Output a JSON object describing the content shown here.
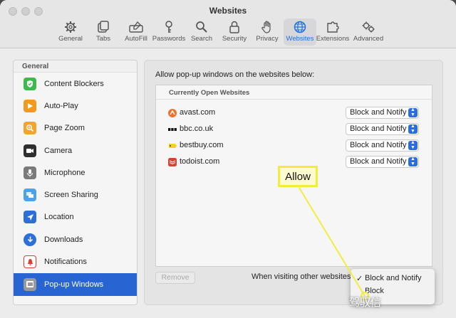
{
  "window": {
    "title": "Websites"
  },
  "toolbar": {
    "items": [
      {
        "label": "General",
        "icon": "gear-icon"
      },
      {
        "label": "Tabs",
        "icon": "tabs-icon"
      },
      {
        "label": "AutoFill",
        "icon": "autofill-icon"
      },
      {
        "label": "Passwords",
        "icon": "key-icon"
      },
      {
        "label": "Search",
        "icon": "search-icon"
      },
      {
        "label": "Security",
        "icon": "lock-icon"
      },
      {
        "label": "Privacy",
        "icon": "hand-icon"
      },
      {
        "label": "Websites",
        "icon": "globe-icon",
        "active": true
      },
      {
        "label": "Extensions",
        "icon": "puzzle-icon"
      },
      {
        "label": "Advanced",
        "icon": "gears-icon"
      }
    ],
    "active_color": "#1a73e8"
  },
  "sidebar": {
    "header": "General",
    "items": [
      {
        "label": "Content Blockers",
        "icon": "shield-check-icon",
        "color": "#3dbb4a"
      },
      {
        "label": "Auto-Play",
        "icon": "play-icon",
        "color": "#f29a1c"
      },
      {
        "label": "Page Zoom",
        "icon": "zoom-icon",
        "color": "#f1a52b"
      },
      {
        "label": "Camera",
        "icon": "camera-icon",
        "color": "#2f2f2f"
      },
      {
        "label": "Microphone",
        "icon": "microphone-icon",
        "color": "#7a7a7a"
      },
      {
        "label": "Screen Sharing",
        "icon": "screen-sharing-icon",
        "color": "#4aa3e8"
      },
      {
        "label": "Location",
        "icon": "location-icon",
        "color": "#2d6fd8"
      },
      {
        "label": "Downloads",
        "icon": "downloads-icon",
        "color": "#2d6fd8"
      },
      {
        "label": "Notifications",
        "icon": "bell-icon",
        "color": "#e03c2f"
      },
      {
        "label": "Pop-up Windows",
        "icon": "popup-windows-icon",
        "color": "#9a9a9a",
        "selected": true
      }
    ],
    "selected_color": "#2864d2"
  },
  "main": {
    "heading": "Allow pop-up windows on the websites below:",
    "list_header": "Currently Open Websites",
    "sites": [
      {
        "name": "avast.com",
        "setting": "Block and Notify",
        "icon": "avast-icon"
      },
      {
        "name": "bbc.co.uk",
        "setting": "Block and Notify",
        "icon": "bbc-icon"
      },
      {
        "name": "bestbuy.com",
        "setting": "Block and Notify",
        "icon": "bestbuy-icon"
      },
      {
        "name": "todoist.com",
        "setting": "Block and Notify",
        "icon": "todoist-icon"
      }
    ],
    "remove_label": "Remove",
    "visiting_label": "When visiting other websites"
  },
  "menu": {
    "items": [
      {
        "label": "Block and Notify",
        "checked": true
      },
      {
        "label": "Block",
        "checked": false
      }
    ]
  },
  "callout": {
    "label": "Allow",
    "color": "#f2ec3f"
  },
  "watermark": "驾驭信"
}
